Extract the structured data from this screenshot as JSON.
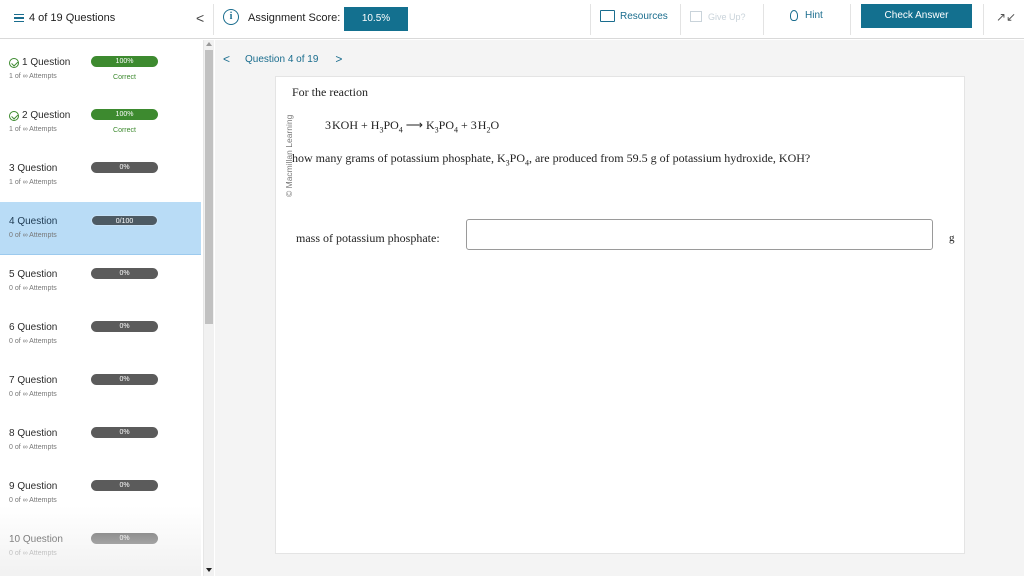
{
  "header": {
    "question_count": "4 of 19 Questions",
    "collapse_glyph": "<",
    "score_label": "Assignment Score:",
    "score_value": "10.5%",
    "resources_label": "Resources",
    "give_up_label": "Give Up?",
    "hint_label": "Hint",
    "check_answer_label": "Check Answer",
    "icons": [
      "list-icon",
      "info-icon",
      "folder-icon",
      "flag-icon",
      "lightbulb-icon",
      "collapse-arrows-icon"
    ]
  },
  "sidebar": {
    "items": [
      {
        "title": "1 Question",
        "attempts": "1 of ∞ Attempts",
        "score": "100%",
        "status": "Correct",
        "done": true
      },
      {
        "title": "2 Question",
        "attempts": "1 of ∞ Attempts",
        "score": "100%",
        "status": "Correct",
        "done": true
      },
      {
        "title": "3 Question",
        "attempts": "1 of ∞ Attempts",
        "score": "0%",
        "status": "",
        "done": false
      },
      {
        "title": "4 Question",
        "attempts": "0 of ∞ Attempts",
        "score": "0/100",
        "status": "",
        "done": false,
        "active": true
      },
      {
        "title": "5 Question",
        "attempts": "0 of ∞ Attempts",
        "score": "0%",
        "status": "",
        "done": false
      },
      {
        "title": "6 Question",
        "attempts": "0 of ∞ Attempts",
        "score": "0%",
        "status": "",
        "done": false
      },
      {
        "title": "7 Question",
        "attempts": "0 of ∞ Attempts",
        "score": "0%",
        "status": "",
        "done": false
      },
      {
        "title": "8 Question",
        "attempts": "0 of ∞ Attempts",
        "score": "0%",
        "status": "",
        "done": false
      },
      {
        "title": "9 Question",
        "attempts": "0 of ∞ Attempts",
        "score": "0%",
        "status": "",
        "done": false
      },
      {
        "title": "10 Question",
        "attempts": "0 of ∞ Attempts",
        "score": "0%",
        "status": "",
        "done": false
      }
    ]
  },
  "main": {
    "question_nav_label": "Question 4 of 19",
    "prev_glyph": "<",
    "next_glyph": ">",
    "copyright": "© Macmillan Learning",
    "prompt": "For the reaction",
    "question_prefix": "how many grams of potassium phosphate, K",
    "question_middle": "PO",
    "question_suffix": ", are produced from 59.5 g of potassium hydroxide, KOH?",
    "answer_label": "mass of potassium phosphate:",
    "answer_value": "",
    "unit": "g"
  }
}
